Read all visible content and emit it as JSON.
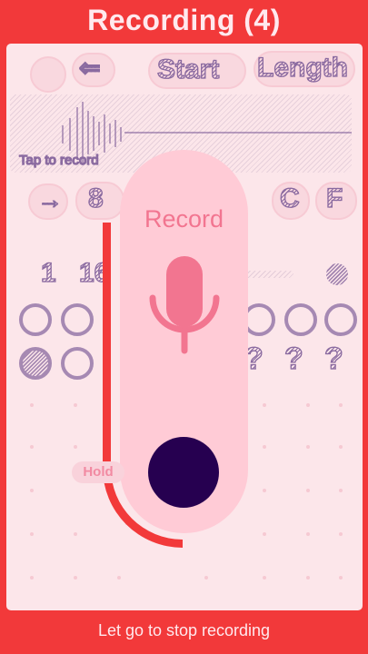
{
  "header": {
    "title": "Recording (4)"
  },
  "background_sheet": {
    "controls_row": {
      "sort_start_label": "Start",
      "sort_length_label": "Length"
    },
    "waveform": {
      "hint": "Tap to record"
    },
    "units_row": {
      "value_partial": "8",
      "unit_c": "C",
      "unit_f": "F"
    },
    "keypad_row": {
      "digit_1": "1",
      "digit_16": "16"
    },
    "query_marks": [
      "?",
      "?",
      "?"
    ]
  },
  "recorder": {
    "record_label": "Record",
    "hold_label": "Hold",
    "mic_icon": "microphone-icon"
  },
  "footer": {
    "hint": "Let go to stop recording"
  },
  "colors": {
    "accent": "#f2393a",
    "panel": "#fce6ea",
    "card": "#ffcbd6",
    "mic": "#f27590",
    "button": "#260050"
  }
}
